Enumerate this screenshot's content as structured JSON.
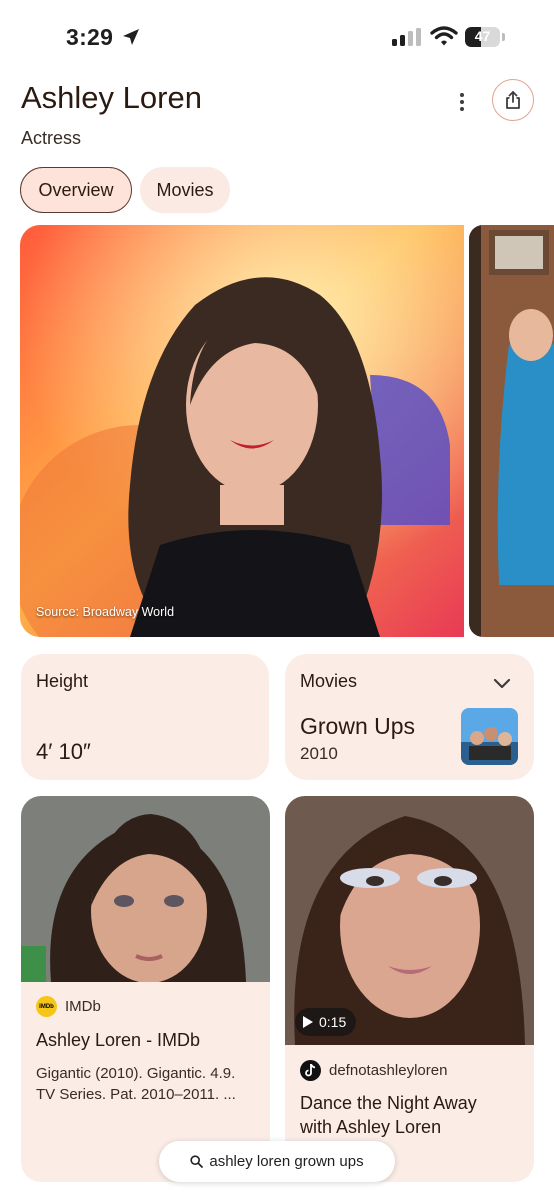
{
  "status_bar": {
    "time": "3:29",
    "battery": "47",
    "battery_level": 0.47
  },
  "header": {
    "title": "Ashley Loren",
    "subtitle": "Actress"
  },
  "tabs": [
    {
      "label": "Overview",
      "selected": true
    },
    {
      "label": "Movies",
      "selected": false
    }
  ],
  "hero": {
    "source": "Source: Broadway World"
  },
  "facts": {
    "height": {
      "label": "Height",
      "value": "4′ 10″"
    },
    "movies": {
      "label": "Movies",
      "title": "Grown Ups",
      "year": "2010"
    }
  },
  "results": [
    {
      "site": "IMDb",
      "title": "Ashley Loren - IMDb",
      "snippet_line1": "Gigantic (2010). Gigantic. 4.9.",
      "snippet_line2": "TV Series. Pat. 2010–2011. ..."
    },
    {
      "duration": "0:15",
      "site": "defnotashleyloren",
      "title_line1": "Dance the Night Away",
      "title_line2": "with Ashley Loren"
    }
  ],
  "search_chip": {
    "query": "ashley loren grown ups"
  },
  "colors": {
    "accent": "#e2a48f",
    "card_bg": "#fbece6",
    "tab_selected_bg": "#fde3da",
    "text": "#2b1a12"
  },
  "icons": [
    "location-arrow-icon",
    "signal-icon",
    "wifi-icon",
    "battery-icon",
    "more-vert-icon",
    "share-icon",
    "chevron-down-icon",
    "imdb-icon",
    "tiktok-icon",
    "play-icon",
    "search-icon"
  ]
}
